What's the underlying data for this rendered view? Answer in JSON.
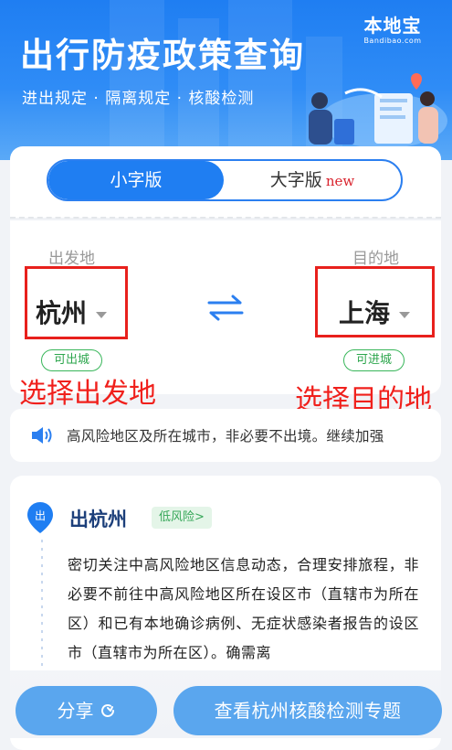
{
  "header": {
    "title": "出行防疫政策查询",
    "subtitle": "进出规定 · 隔离规定 · 核酸检测",
    "logo_main": "本地宝",
    "logo_url": "Bandibao.com"
  },
  "version_toggle": {
    "small_label": "小字版",
    "large_label": "大字版",
    "new_tag": "new",
    "selected": "小字版"
  },
  "route": {
    "from_label": "出发地",
    "to_label": "目的地",
    "from_city": "杭州",
    "to_city": "上海",
    "from_status": "可出城",
    "to_status": "可进城",
    "annotation_from": "选择出发地",
    "annotation_to": "选择目的地"
  },
  "notice": {
    "text": "高风险地区及所在城市，非必要不出境。继续加强"
  },
  "outbound": {
    "pin_char": "出",
    "title": "出杭州",
    "risk_label": "低风险>",
    "paragraph": "密切关注中高风险地区信息动态，合理安排旅程，非必要不前往中高风险地区所在设区市（直辖市为所在区）和已有本地确诊病例、无症状感染者报告的设区市（直辖市为所在区）。确需离"
  },
  "actions": {
    "share_label": "分享",
    "test_label": "查看杭州核酸检测专题"
  },
  "colors": {
    "primary": "#1f7ef2",
    "button": "#5aa6ee",
    "annotation_red": "#e8201c",
    "status_green": "#38b65a",
    "title_navy": "#1c3f7a"
  }
}
